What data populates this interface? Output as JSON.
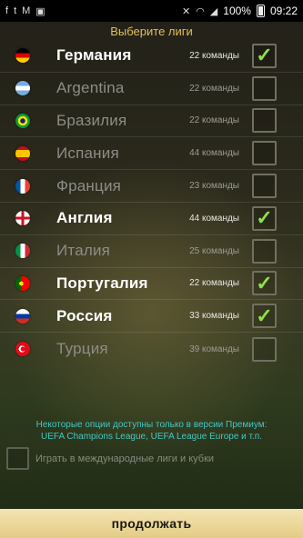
{
  "statusbar": {
    "left_icons": [
      "f",
      "t",
      "M",
      "▣"
    ],
    "battery": "100%",
    "time": "09:22"
  },
  "header": {
    "title": "Выберите лиги"
  },
  "leagues": [
    {
      "name": "Германия",
      "count": "22 команды",
      "checked": true
    },
    {
      "name": "Argentina",
      "count": "22 команды",
      "checked": false
    },
    {
      "name": "Бразилия",
      "count": "22 команды",
      "checked": false
    },
    {
      "name": "Испания",
      "count": "44 команды",
      "checked": false
    },
    {
      "name": "Франция",
      "count": "23 команды",
      "checked": false
    },
    {
      "name": "Англия",
      "count": "44 команды",
      "checked": true
    },
    {
      "name": "Италия",
      "count": "25 команды",
      "checked": false
    },
    {
      "name": "Португалия",
      "count": "22 команды",
      "checked": true
    },
    {
      "name": "Россия",
      "count": "33 команды",
      "checked": true
    },
    {
      "name": "Турция",
      "count": "39 команды",
      "checked": false
    }
  ],
  "premium_note": {
    "line1": "Некоторые опции доступны только в версии Премиум:",
    "line2": "UEFA Champions League, UEFA League Europe и т.п."
  },
  "international": {
    "label": "Играть в международные лиги и кубки",
    "checked": false
  },
  "continue_button": {
    "label": "продолжать"
  },
  "colors": {
    "accent_title": "#e0c05a",
    "check": "#8ee04a",
    "premium_text": "#41c8c4",
    "button_bg": "#efdda4"
  }
}
